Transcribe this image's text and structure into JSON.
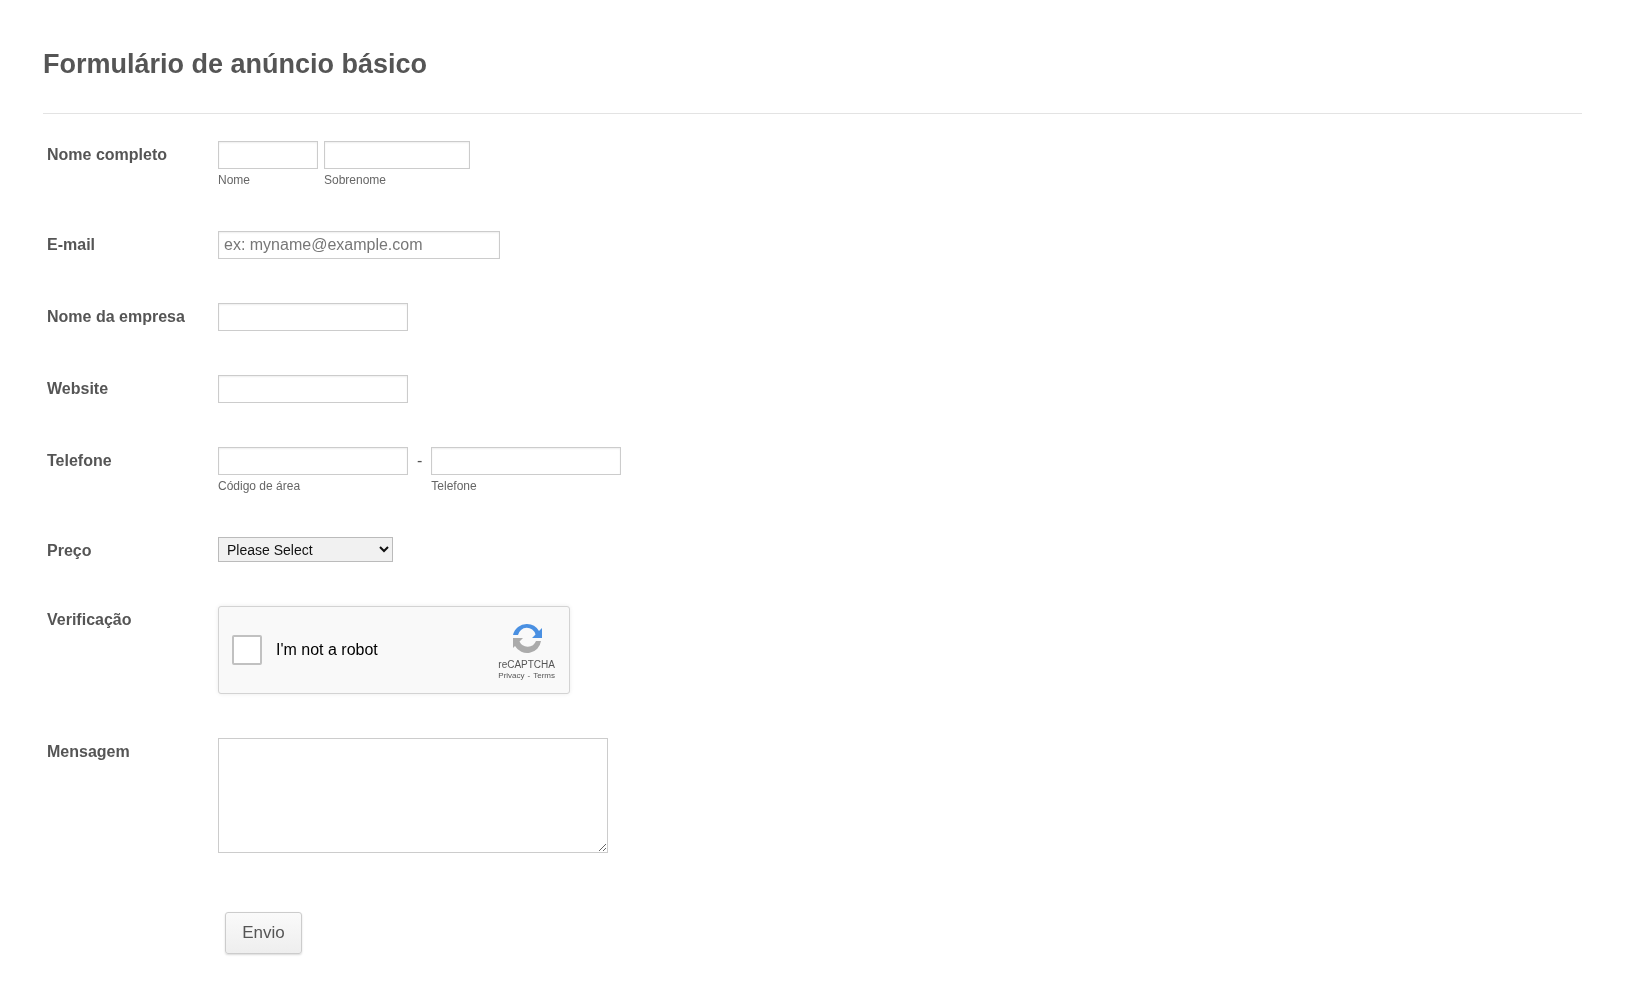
{
  "title": "Formulário de anúncio básico",
  "fields": [
    {
      "kind": "name",
      "label": "Nome completo",
      "parts": [
        {
          "sublabel": "Nome"
        },
        {
          "sublabel": "Sobrenome"
        }
      ]
    },
    {
      "kind": "email",
      "label": "E-mail",
      "placeholder": "ex: myname@example.com"
    },
    {
      "kind": "text",
      "label": "Nome da empresa"
    },
    {
      "kind": "text",
      "label": "Website"
    },
    {
      "kind": "phone",
      "label": "Telefone",
      "separator": "-",
      "parts": [
        {
          "sublabel": "Código de área"
        },
        {
          "sublabel": "Telefone"
        }
      ]
    },
    {
      "kind": "select",
      "label": "Preço",
      "value": "Please Select"
    },
    {
      "kind": "captcha",
      "label": "Verificação",
      "checked": false,
      "text": "I'm not a robot",
      "brand": "reCAPTCHA",
      "privacy": "Privacy",
      "separator": "-",
      "terms": "Terms"
    },
    {
      "kind": "textarea",
      "label": "Mensagem"
    }
  ],
  "submit": "Envio"
}
